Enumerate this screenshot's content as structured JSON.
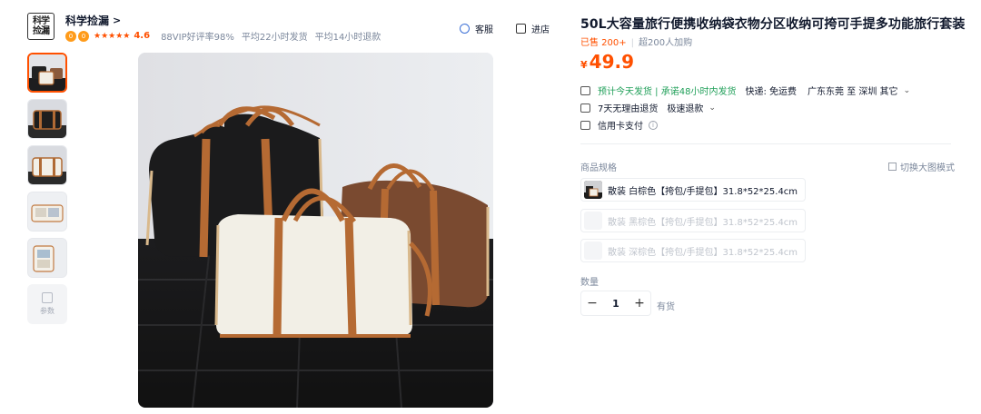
{
  "shop": {
    "logo_line1": "科学",
    "logo_line2": "捡漏",
    "name": "科学捡漏",
    "name_chevron": ">",
    "badge_text": "0",
    "stars": "★★★★★",
    "rating": "4.6",
    "vip_rate": "88VIP好评率98%",
    "ship_time": "平均22小时发货",
    "refund_time": "平均14小时退款"
  },
  "actions": {
    "service_label": "客服",
    "store_label": "进店"
  },
  "thumbnails": {
    "count": 5,
    "more_label": "参数"
  },
  "product": {
    "title": "50L大容量旅行便携收纳袋衣物分区收纳可挎可手提多功能旅行套装",
    "sold_label": "已售 200+",
    "cart_label": "超200人加购",
    "currency": "¥",
    "price": "49.9"
  },
  "shipping": {
    "promise": "预计今天发货 | 承诺48小时内发货",
    "express": "快递: 免运费",
    "route": "广东东莞 至 深圳 其它",
    "return_policy": "7天无理由退货",
    "refund": "极速退款",
    "payment": "信用卡支付"
  },
  "specs": {
    "label": "商品规格",
    "switch_label": "切换大图模式",
    "options": [
      {
        "label": "散装 白棕色【挎包/手提包】31.8*52*25.4cm",
        "disabled": false
      },
      {
        "label": "散装 黑棕色【挎包/手提包】31.8*52*25.4cm",
        "disabled": true
      },
      {
        "label": "散装 深棕色【挎包/手提包】31.8*52*25.4cm",
        "disabled": true
      }
    ]
  },
  "quantity": {
    "label": "数量",
    "minus": "−",
    "value": "1",
    "plus": "+",
    "stock": "有货"
  },
  "colors": {
    "accent": "#ff5000",
    "green": "#1f9f58",
    "text": "#11192d",
    "muted": "#7c889c"
  }
}
